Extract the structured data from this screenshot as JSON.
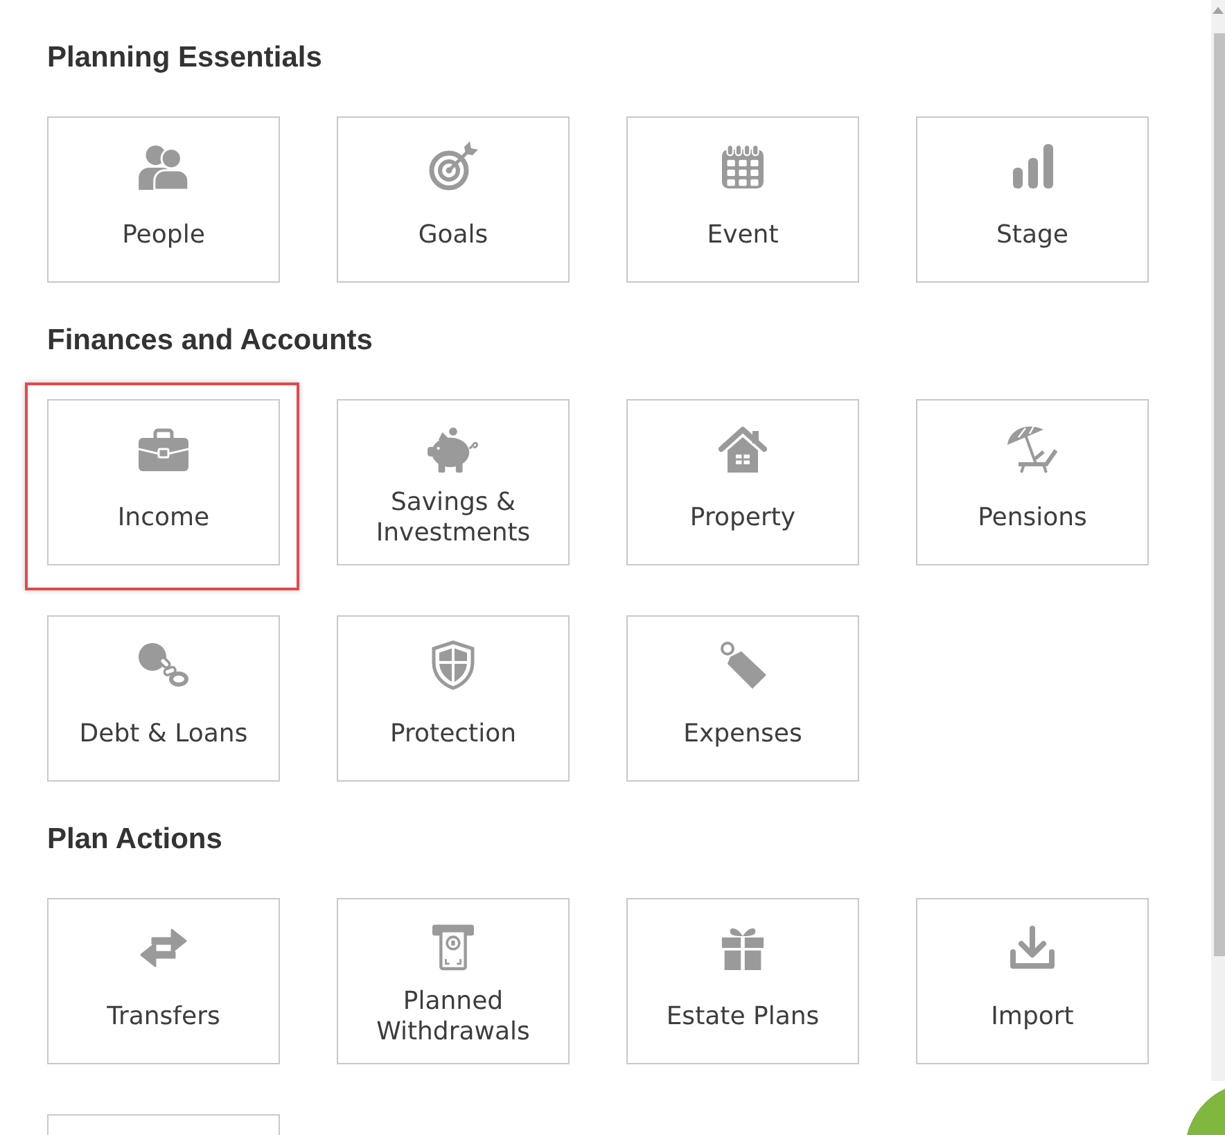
{
  "sections": [
    {
      "title": "Planning Essentials",
      "tiles": [
        {
          "label": "People",
          "selected": false
        },
        {
          "label": "Goals",
          "selected": false
        },
        {
          "label": "Event",
          "selected": false
        },
        {
          "label": "Stage",
          "selected": false
        }
      ]
    },
    {
      "title": "Finances and Accounts",
      "tiles": [
        {
          "label": "Income",
          "selected": true
        },
        {
          "label": "Savings & Investments",
          "selected": false
        },
        {
          "label": "Property",
          "selected": false
        },
        {
          "label": "Pensions",
          "selected": false
        },
        {
          "label": "Debt & Loans",
          "selected": false
        },
        {
          "label": "Protection",
          "selected": false
        },
        {
          "label": "Expenses",
          "selected": false
        }
      ]
    },
    {
      "title": "Plan Actions",
      "tiles": [
        {
          "label": "Transfers",
          "selected": false
        },
        {
          "label": "Planned Withdrawals",
          "selected": false
        },
        {
          "label": "Estate Plans",
          "selected": false
        },
        {
          "label": "Import",
          "selected": false
        },
        {
          "selected": false
        }
      ]
    }
  ]
}
